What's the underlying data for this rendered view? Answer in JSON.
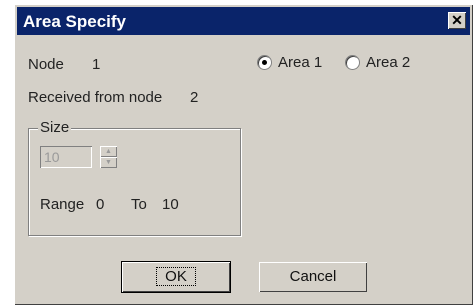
{
  "window": {
    "title": "Area Specify",
    "close_glyph": "✕"
  },
  "node": {
    "label": "Node",
    "value": "1"
  },
  "received": {
    "label": "Received from node",
    "value": "2"
  },
  "area_options": [
    {
      "label": "Area 1",
      "checked": true
    },
    {
      "label": "Area 2",
      "checked": false
    }
  ],
  "size": {
    "group_label": "Size",
    "value": "10",
    "range_label": "Range",
    "range_from": "0",
    "to_label": "To",
    "range_to": "10"
  },
  "buttons": {
    "ok": "OK",
    "cancel": "Cancel"
  },
  "icons": {
    "close": "close-icon",
    "spin_up": "spin-up-icon",
    "spin_down": "spin-down-icon",
    "radio": "radio-icon"
  }
}
